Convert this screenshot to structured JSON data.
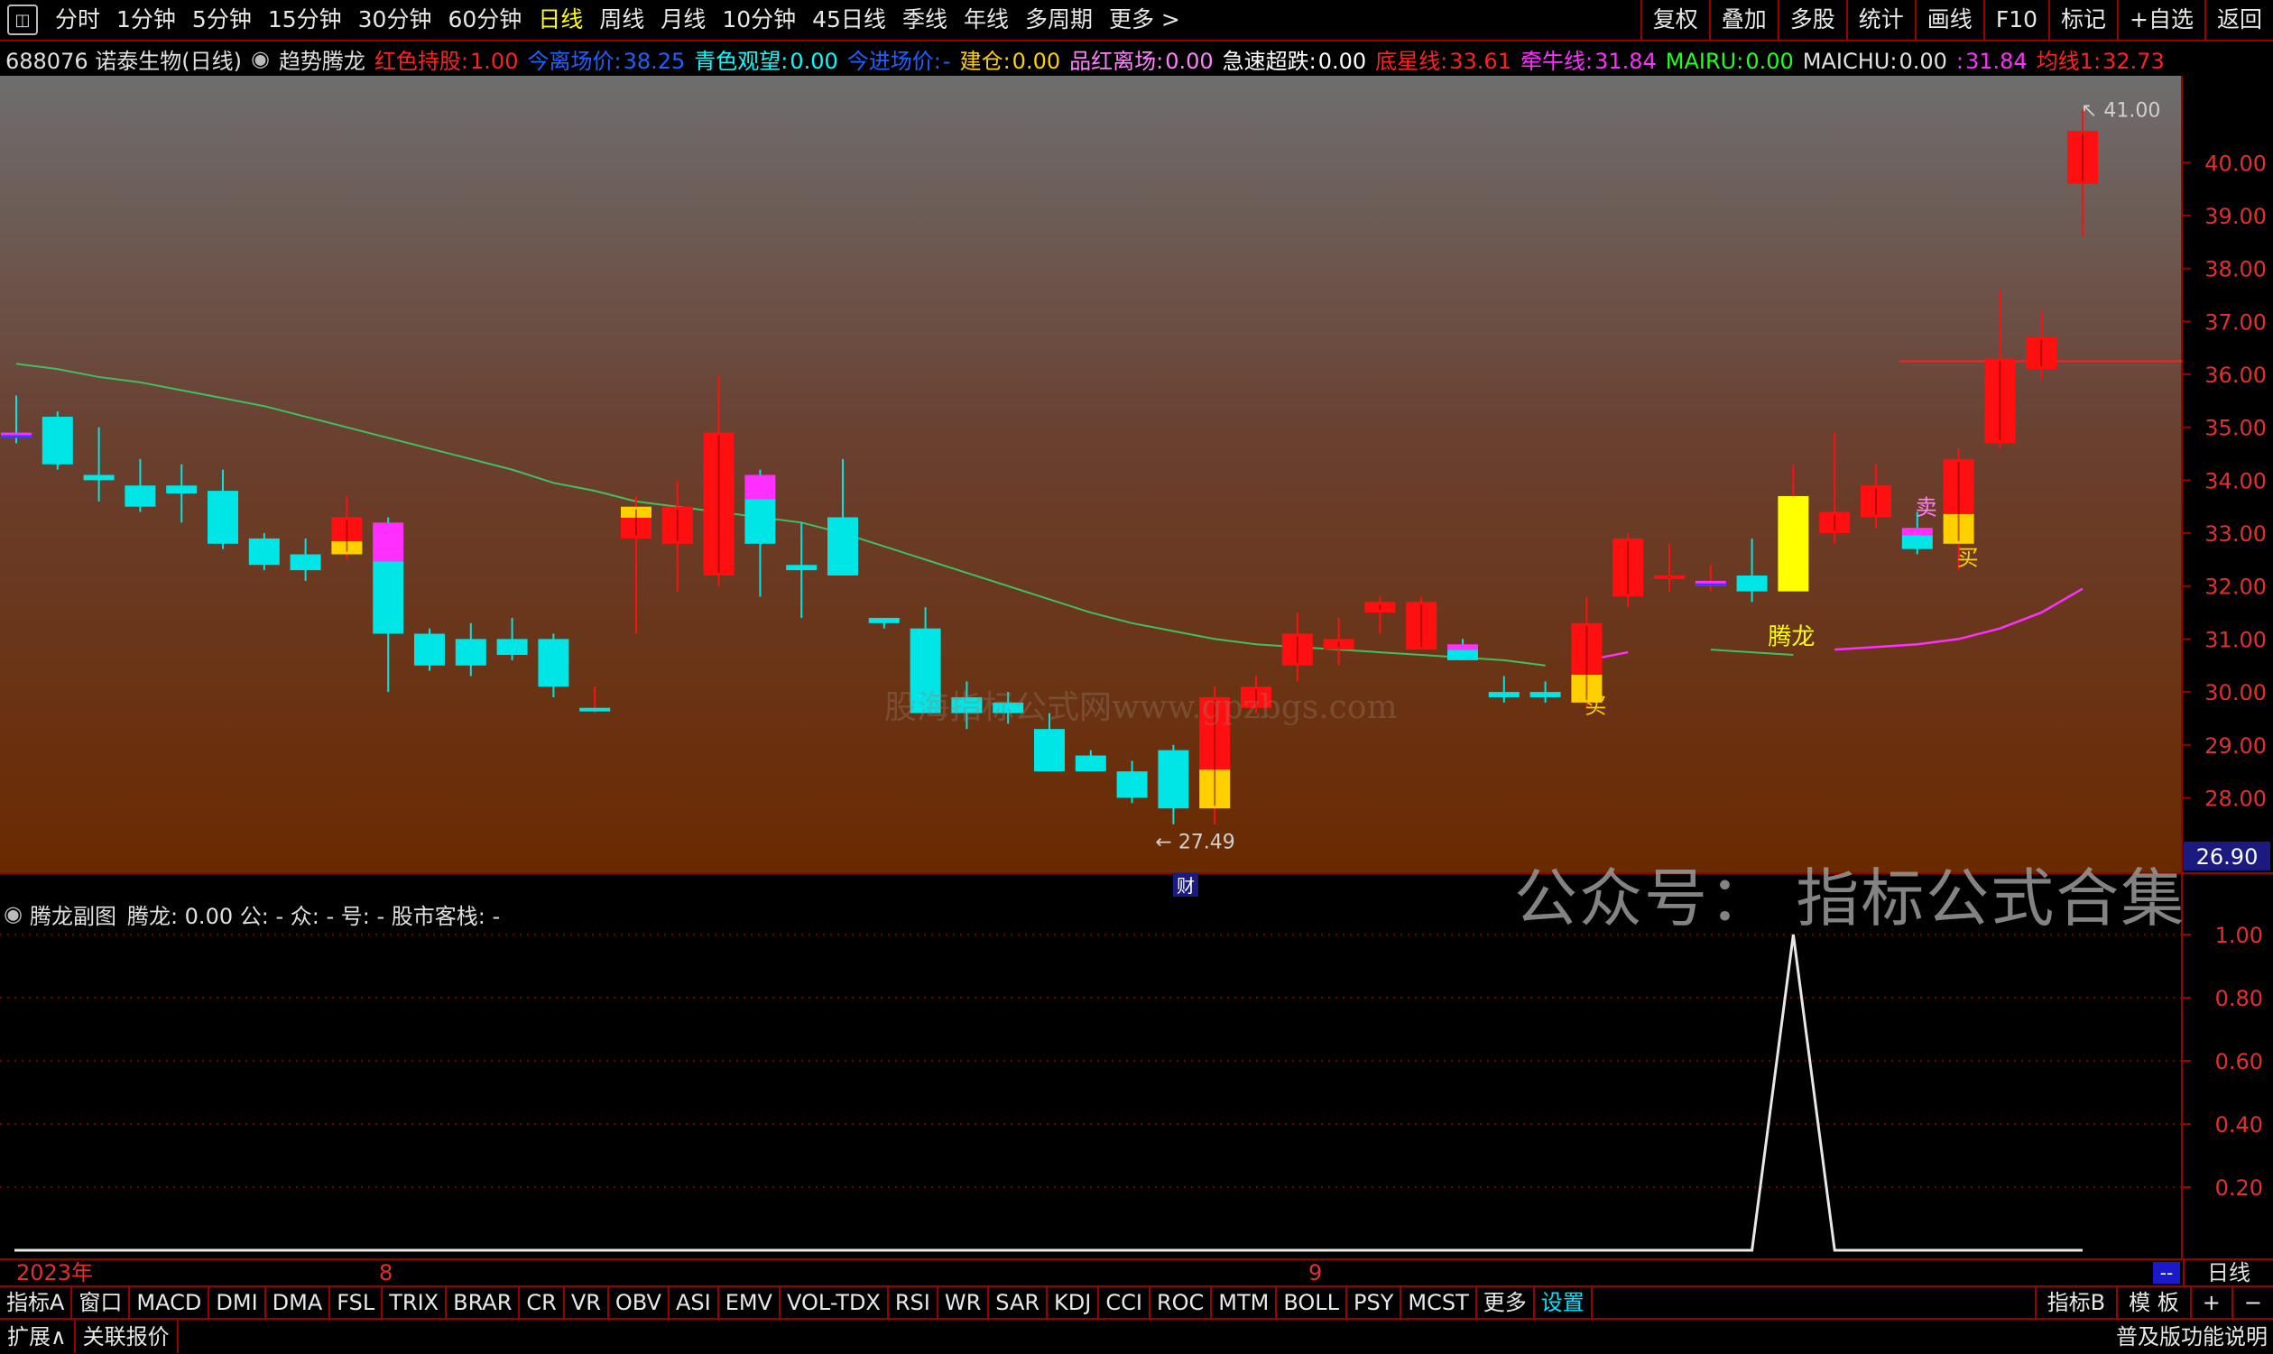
{
  "toolbar": {
    "periods": [
      "分时",
      "1分钟",
      "5分钟",
      "15分钟",
      "30分钟",
      "60分钟",
      "日线",
      "周线",
      "月线",
      "10分钟",
      "45日线",
      "季线",
      "年线",
      "多周期",
      "更多 >"
    ],
    "active_period": "日线",
    "right_tools": [
      "复权",
      "叠加",
      "多股",
      "统计",
      "画线",
      "F10",
      "标记",
      "+自选",
      "返回"
    ]
  },
  "info": {
    "stock": "688076 诺泰生物(日线)",
    "indicator": "趋势腾龙",
    "fields": [
      {
        "label": "红色持股:",
        "value": "1.00",
        "color": "#ff2020"
      },
      {
        "label": "今离场价:",
        "value": "38.25",
        "color": "#2060ff"
      },
      {
        "label": "青色观望:",
        "value": "0.00",
        "color": "#00ffff"
      },
      {
        "label": "今进场价:",
        "value": "-",
        "color": "#2060ff"
      },
      {
        "label": "建仓:",
        "value": "0.00",
        "color": "#ffd000"
      },
      {
        "label": "品红离场:",
        "value": "0.00",
        "color": "#ff80ff"
      },
      {
        "label": "急速超跌:",
        "value": "0.00",
        "color": "#ffffff"
      },
      {
        "label": "底星线:",
        "value": "33.61",
        "color": "#ff2020"
      },
      {
        "label": "牵牛线:",
        "value": "31.84",
        "color": "#ff30ff"
      },
      {
        "label": "MAIRU:",
        "value": "0.00",
        "color": "#20ff20"
      },
      {
        "label": "MAICHU:",
        "value": "0.00",
        "color": "#e0e0e0"
      },
      {
        "label": ":",
        "value": "31.84",
        "color": "#ff30ff"
      },
      {
        "label": "均线1:",
        "value": "32.73",
        "color": "#ff2020"
      }
    ]
  },
  "price_axis": {
    "labels": [
      "40.00",
      "39.00",
      "38.00",
      "37.00",
      "36.00",
      "35.00",
      "34.00",
      "33.00",
      "32.00",
      "31.00",
      "30.00",
      "29.00",
      "28.00"
    ],
    "current": "26.90"
  },
  "annotations": {
    "high": "41.00",
    "low": "27.49",
    "tenglong": "腾龙",
    "sell": "卖",
    "buy": "买",
    "finance_marker": "财"
  },
  "sub": {
    "title": "腾龙副图",
    "fields": "腾龙: 0.00  公: -  众: -  号: -  股市客栈: -",
    "axis": [
      "1.00",
      "0.80",
      "0.60",
      "0.40",
      "0.20"
    ]
  },
  "watermark": "公众号：  指标公式合集",
  "watermark2": "股海指标公式网www.gpzbgs.com",
  "dates": {
    "year": "2023年",
    "m8": "8",
    "m9": "9",
    "period_label": "日线",
    "dash": "--"
  },
  "indicator_tabs": [
    "指标A",
    "窗口",
    "MACD",
    "DMI",
    "DMA",
    "FSL",
    "TRIX",
    "BRAR",
    "CR",
    "VR",
    "OBV",
    "ASI",
    "EMV",
    "VOL-TDX",
    "RSI",
    "WR",
    "SAR",
    "KDJ",
    "CCI",
    "ROC",
    "MTM",
    "BOLL",
    "PSY",
    "MCST",
    "更多",
    "设置"
  ],
  "indicator_right": [
    "指标B",
    "模 板",
    "+",
    "−"
  ],
  "status_tabs": [
    "扩展∧",
    "关联报价"
  ],
  "status_right": "普及版功能说明",
  "colors": {
    "up": "#ff1010",
    "down": "#00e5e5",
    "hold": "#ffd000",
    "magenta": "#ff30ff",
    "ma": "#40c060",
    "grid": "#9a0000"
  },
  "chart_data": {
    "type": "candlestick",
    "price_range": [
      26.9,
      41.3
    ],
    "candles": [
      {
        "o": 34.9,
        "h": 35.6,
        "l": 34.7,
        "c": 34.8,
        "s": "m"
      },
      {
        "o": 35.2,
        "h": 35.3,
        "l": 34.2,
        "c": 34.3,
        "s": "d"
      },
      {
        "o": 34.1,
        "h": 35.0,
        "l": 33.6,
        "c": 34.0,
        "s": "d"
      },
      {
        "o": 33.9,
        "h": 34.4,
        "l": 33.4,
        "c": 33.5,
        "s": "d"
      },
      {
        "o": 33.9,
        "h": 34.3,
        "l": 33.2,
        "c": 33.75,
        "s": "d"
      },
      {
        "o": 33.8,
        "h": 34.2,
        "l": 32.7,
        "c": 32.8,
        "s": "d"
      },
      {
        "o": 32.9,
        "h": 33.0,
        "l": 32.3,
        "c": 32.4,
        "s": "d"
      },
      {
        "o": 32.6,
        "h": 32.9,
        "l": 32.1,
        "c": 32.3,
        "s": "d"
      },
      {
        "o": 32.6,
        "h": 33.7,
        "l": 32.5,
        "c": 33.3,
        "s": "ry"
      },
      {
        "o": 33.2,
        "h": 33.3,
        "l": 30.0,
        "c": 31.1,
        "s": "mc"
      },
      {
        "o": 31.1,
        "h": 31.2,
        "l": 30.4,
        "c": 30.5,
        "s": "d"
      },
      {
        "o": 31.0,
        "h": 31.3,
        "l": 30.3,
        "c": 30.5,
        "s": "d"
      },
      {
        "o": 31.0,
        "h": 31.4,
        "l": 30.6,
        "c": 30.7,
        "s": "d"
      },
      {
        "o": 31.0,
        "h": 31.1,
        "l": 29.9,
        "c": 30.1,
        "s": "d"
      },
      {
        "o": 29.7,
        "h": 30.1,
        "l": 29.6,
        "c": 29.7,
        "s": "d"
      },
      {
        "o": 32.9,
        "h": 33.7,
        "l": 31.1,
        "c": 33.5,
        "s": "yr"
      },
      {
        "o": 32.8,
        "h": 34.0,
        "l": 31.9,
        "c": 33.5,
        "s": "r"
      },
      {
        "o": 32.2,
        "h": 36.0,
        "l": 32.0,
        "c": 34.9,
        "s": "r"
      },
      {
        "o": 34.1,
        "h": 34.2,
        "l": 31.8,
        "c": 32.8,
        "s": "mc"
      },
      {
        "o": 32.4,
        "h": 33.2,
        "l": 31.4,
        "c": 32.3,
        "s": "d"
      },
      {
        "o": 33.3,
        "h": 34.4,
        "l": 32.2,
        "c": 32.2,
        "s": "d"
      },
      {
        "o": 31.4,
        "h": 31.4,
        "l": 31.2,
        "c": 31.3,
        "s": "d"
      },
      {
        "o": 31.2,
        "h": 31.6,
        "l": 29.9,
        "c": 29.6,
        "s": "d"
      },
      {
        "o": 29.9,
        "h": 30.2,
        "l": 29.3,
        "c": 29.6,
        "s": "d"
      },
      {
        "o": 29.8,
        "h": 30.0,
        "l": 29.4,
        "c": 29.6,
        "s": "d"
      },
      {
        "o": 29.3,
        "h": 29.6,
        "l": 28.6,
        "c": 28.5,
        "s": "d"
      },
      {
        "o": 28.8,
        "h": 28.9,
        "l": 28.5,
        "c": 28.5,
        "s": "d"
      },
      {
        "o": 28.5,
        "h": 28.7,
        "l": 27.9,
        "c": 28.0,
        "s": "d"
      },
      {
        "o": 28.9,
        "h": 29.0,
        "l": 27.5,
        "c": 27.8,
        "s": "d"
      },
      {
        "o": 27.8,
        "h": 30.1,
        "l": 27.5,
        "c": 29.9,
        "s": "ry"
      },
      {
        "o": 29.7,
        "h": 30.3,
        "l": 29.6,
        "c": 30.1,
        "s": "r"
      },
      {
        "o": 30.5,
        "h": 31.5,
        "l": 30.2,
        "c": 31.1,
        "s": "r"
      },
      {
        "o": 30.8,
        "h": 31.4,
        "l": 30.5,
        "c": 31.0,
        "s": "r"
      },
      {
        "o": 31.5,
        "h": 31.8,
        "l": 31.1,
        "c": 31.7,
        "s": "r"
      },
      {
        "o": 30.8,
        "h": 31.8,
        "l": 30.8,
        "c": 31.7,
        "s": "r"
      },
      {
        "o": 30.9,
        "h": 31.0,
        "l": 30.6,
        "c": 30.6,
        "s": "mc"
      },
      {
        "o": 30.0,
        "h": 30.3,
        "l": 29.8,
        "c": 29.9,
        "s": "d"
      },
      {
        "o": 30.0,
        "h": 30.2,
        "l": 29.8,
        "c": 29.9,
        "s": "d"
      },
      {
        "o": 29.8,
        "h": 31.8,
        "l": 29.7,
        "c": 31.3,
        "s": "ry"
      },
      {
        "o": 31.8,
        "h": 33.0,
        "l": 31.6,
        "c": 32.9,
        "s": "r"
      },
      {
        "o": 32.2,
        "h": 32.8,
        "l": 31.9,
        "c": 32.2,
        "s": "r"
      },
      {
        "o": 32.0,
        "h": 32.4,
        "l": 31.9,
        "c": 32.1,
        "s": "m"
      },
      {
        "o": 32.2,
        "h": 32.9,
        "l": 31.7,
        "c": 31.9,
        "s": "d"
      },
      {
        "o": 31.9,
        "h": 34.3,
        "l": 31.9,
        "c": 33.7,
        "s": "y"
      },
      {
        "o": 33.0,
        "h": 34.9,
        "l": 32.8,
        "c": 33.4,
        "s": "r"
      },
      {
        "o": 33.3,
        "h": 34.3,
        "l": 33.1,
        "c": 33.9,
        "s": "r"
      },
      {
        "o": 33.1,
        "h": 33.4,
        "l": 32.6,
        "c": 32.7,
        "s": "mc"
      },
      {
        "o": 32.8,
        "h": 34.6,
        "l": 32.3,
        "c": 34.4,
        "s": "ry"
      },
      {
        "o": 34.7,
        "h": 37.6,
        "l": 34.6,
        "c": 36.3,
        "s": "r"
      },
      {
        "o": 36.1,
        "h": 37.2,
        "l": 35.9,
        "c": 36.7,
        "s": "r"
      },
      {
        "o": 39.6,
        "h": 41.0,
        "l": 38.6,
        "c": 40.6,
        "s": "r"
      }
    ],
    "ma_line": [
      36.2,
      36.1,
      35.95,
      35.85,
      35.7,
      35.55,
      35.4,
      35.2,
      35.0,
      34.8,
      34.6,
      34.4,
      34.2,
      33.95,
      33.8,
      33.6,
      33.5,
      33.4,
      33.3,
      33.2,
      33.0,
      32.75,
      32.5,
      32.25,
      32.0,
      31.75,
      31.5,
      31.3,
      31.15,
      31.0,
      30.9,
      30.85,
      30.8,
      30.75,
      30.7,
      30.65,
      30.6,
      30.5
    ],
    "magenta_line": [
      null,
      null,
      null,
      null,
      null,
      null,
      null,
      null,
      null,
      null,
      null,
      null,
      null,
      null,
      null,
      null,
      null,
      null,
      null,
      null,
      null,
      null,
      null,
      null,
      null,
      null,
      null,
      null,
      null,
      null,
      null,
      null,
      null,
      null,
      null,
      null,
      null,
      null,
      30.6,
      30.75,
      null,
      null,
      null,
      null,
      30.8,
      30.85,
      30.9,
      31.0,
      31.2,
      31.5,
      31.95
    ],
    "green_short": [
      null,
      null,
      null,
      null,
      null,
      null,
      null,
      null,
      null,
      null,
      null,
      null,
      null,
      null,
      null,
      null,
      null,
      null,
      null,
      null,
      null,
      null,
      null,
      null,
      null,
      null,
      null,
      null,
      null,
      null,
      null,
      null,
      null,
      null,
      null,
      null,
      null,
      null,
      null,
      null,
      null,
      30.8,
      30.75,
      30.7
    ],
    "resistance": 36.25,
    "sub_signal": [
      0,
      0,
      0,
      0,
      0,
      0,
      0,
      0,
      0,
      0,
      0,
      0,
      0,
      0,
      0,
      0,
      0,
      0,
      0,
      0,
      0,
      0,
      0,
      0,
      0,
      0,
      0,
      0,
      0,
      0,
      0,
      0,
      0,
      0,
      0,
      0,
      0,
      0,
      0,
      0,
      0,
      0,
      0,
      1,
      0,
      0,
      0,
      0,
      0,
      0,
      0
    ],
    "sub_range": [
      0,
      1.0
    ]
  }
}
